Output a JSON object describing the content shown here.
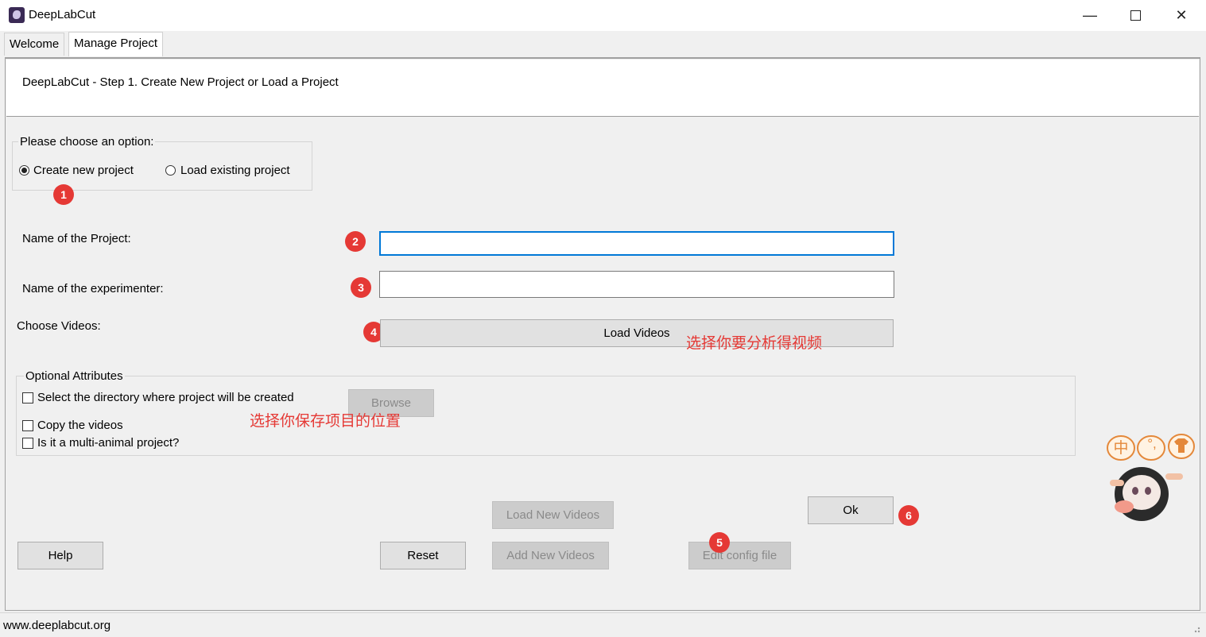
{
  "window": {
    "title": "DeepLabCut"
  },
  "tabs": [
    {
      "label": "Welcome"
    },
    {
      "label": "Manage Project"
    }
  ],
  "header": {
    "step_title": "DeepLabCut - Step 1. Create New Project or Load a Project"
  },
  "options": {
    "group_label": "Please choose an option:",
    "create_label": "Create new project",
    "load_label": "Load existing project",
    "selected": "create"
  },
  "form": {
    "project_name_label": "Name of the Project:",
    "project_name_value": "",
    "experimenter_label": "Name of the experimenter:",
    "experimenter_value": "",
    "choose_videos_label": "Choose Videos:",
    "load_videos_button": "Load Videos"
  },
  "optional": {
    "group_label": "Optional Attributes",
    "select_dir_label": "Select the directory where project will be created",
    "browse_button": "Browse",
    "copy_videos_label": "Copy the videos",
    "multi_animal_label": "Is it a multi-animal project?"
  },
  "buttons": {
    "ok": "Ok",
    "help": "Help",
    "reset": "Reset",
    "load_new_videos": "Load New Videos",
    "add_new_videos": "Add New Videos",
    "edit_config": "Edit config file"
  },
  "annotations": {
    "markers": [
      "1",
      "2",
      "3",
      "4",
      "5",
      "6"
    ],
    "load_videos_note": "选择你要分析得视频",
    "browse_note": "选择你保存项目的位置",
    "marker_color": "#e53935"
  },
  "ime_toolbar": {
    "chinese": "中",
    "punct": "°,",
    "skin_icon": "shirt-icon"
  },
  "status": {
    "text": "www.deeplabcut.org"
  }
}
